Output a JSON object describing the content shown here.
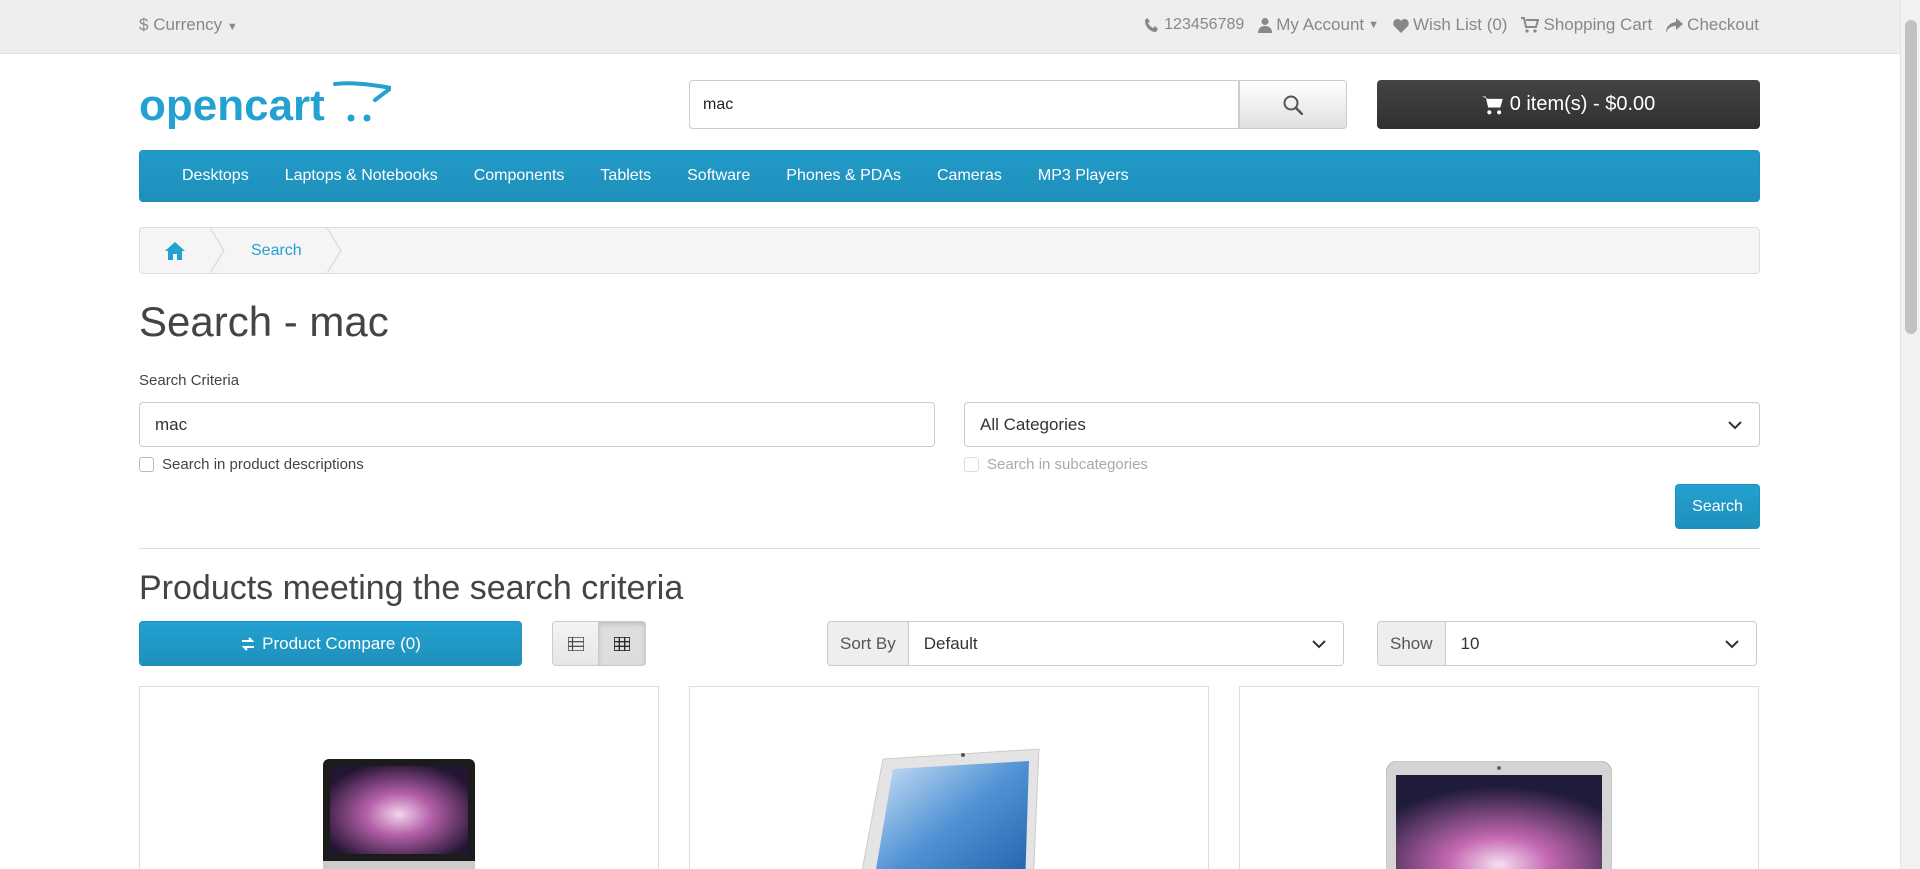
{
  "topbar": {
    "currency_label": "Currency",
    "phone": "123456789",
    "my_account": "My Account",
    "wish_list": "Wish List (0)",
    "shopping_cart": "Shopping Cart",
    "checkout": "Checkout"
  },
  "header": {
    "logo_text": "opencart",
    "search_value": "mac",
    "cart_label": "0 item(s) - $0.00"
  },
  "menu": {
    "items": [
      "Desktops",
      "Laptops & Notebooks",
      "Components",
      "Tablets",
      "Software",
      "Phones & PDAs",
      "Cameras",
      "MP3 Players"
    ]
  },
  "breadcrumb": {
    "current": "Search"
  },
  "page": {
    "title": "Search - mac",
    "criteria_label": "Search Criteria",
    "keyword_value": "mac",
    "category_value": "All Categories",
    "search_descriptions_label": "Search in product descriptions",
    "search_subcategories_label": "Search in subcategories",
    "search_button": "Search",
    "results_heading": "Products meeting the search criteria",
    "compare_button": "Product Compare (0)",
    "sort_label": "Sort By",
    "sort_value": "Default",
    "show_label": "Show",
    "show_value": "10"
  },
  "colors": {
    "brand_blue": "#229ac8",
    "dark_button": "#363636"
  }
}
